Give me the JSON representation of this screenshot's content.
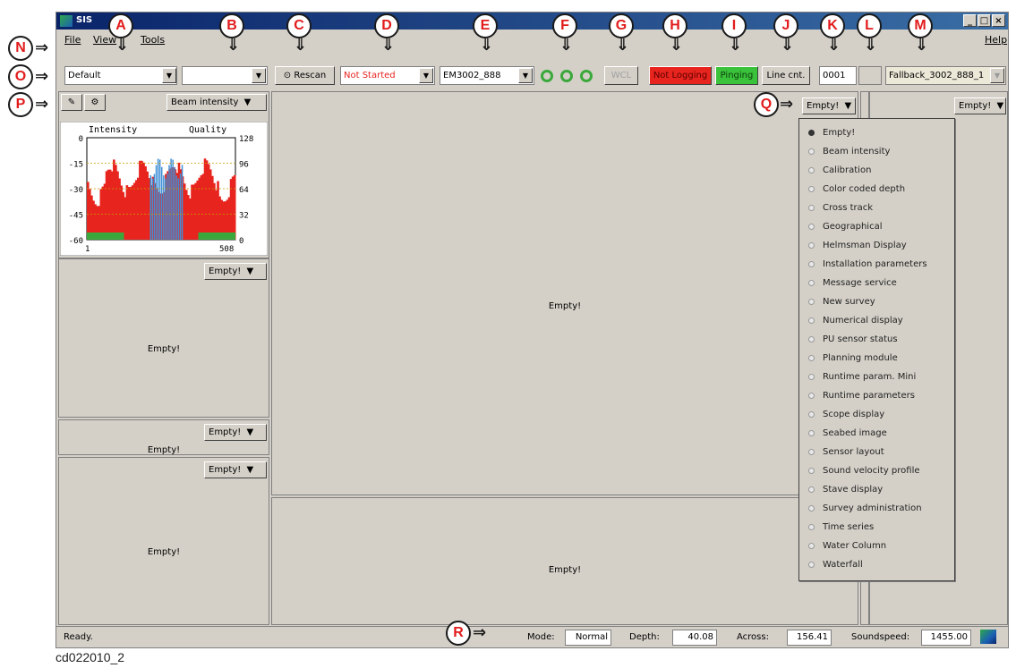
{
  "window": {
    "title": "SIS",
    "minimize": "_",
    "maximize": "□",
    "close": "×"
  },
  "menu": {
    "file": "File",
    "view": "View",
    "tools": "Tools",
    "help": "Help"
  },
  "toolbar": {
    "profile": "Default",
    "profile2": "",
    "rescan": "Rescan",
    "status": "Not Started",
    "sounder": "EM3002_888",
    "wcl": "WCL",
    "logging": "Not Logging",
    "pinging": "Pinging",
    "linecnt": "Line cnt.",
    "line_number": "0001",
    "blank_field": "",
    "fallback": "Fallback_3002_888_1"
  },
  "panels": {
    "beam_dropdown": "Beam intensity",
    "empty_label": "Empty!",
    "empty_dropdown": "Empty!"
  },
  "chart_data": {
    "type": "bar",
    "left_title": "Intensity",
    "right_title": "Quality",
    "left_ticks": [
      "0",
      "-15",
      "-30",
      "-45",
      "-60"
    ],
    "right_ticks": [
      "128",
      "96",
      "64",
      "32",
      "0"
    ],
    "x_ticks": [
      "1",
      "508"
    ],
    "ylim": [
      -60,
      0
    ],
    "xlim": [
      1,
      508
    ],
    "colors": {
      "intensity": "#e8241e",
      "quality": "#3f8fd6",
      "bottom": "#3aa83a"
    }
  },
  "dropdown_menu": {
    "items": [
      "Empty!",
      "Beam intensity",
      "Calibration",
      "Color coded depth",
      "Cross track",
      "Geographical",
      "Helmsman Display",
      "Installation parameters",
      "Message service",
      "New survey",
      "Numerical display",
      "PU sensor status",
      "Planning module",
      "Runtime param. Mini",
      "Runtime parameters",
      "Scope display",
      "Seabed image",
      "Sensor layout",
      "Sound velocity profile",
      "Stave display",
      "Survey administration",
      "Time series",
      "Water Column",
      "Waterfall"
    ],
    "selected": "Empty!"
  },
  "status_bar": {
    "message": "Ready.",
    "mode_label": "Mode:",
    "mode": "Normal",
    "depth_label": "Depth:",
    "depth": "40.08",
    "across_label": "Across:",
    "across": "156.41",
    "soundspeed_label": "Soundspeed:",
    "soundspeed": "1455.00"
  },
  "callouts": {
    "a": "A",
    "b": "B",
    "c": "C",
    "d": "D",
    "e": "E",
    "f": "F",
    "g": "G",
    "h": "H",
    "i": "I",
    "j": "J",
    "k": "K",
    "l": "L",
    "m": "M",
    "n": "N",
    "o": "O",
    "p": "P",
    "q": "Q",
    "r": "R"
  },
  "caption": "cd022010_2"
}
